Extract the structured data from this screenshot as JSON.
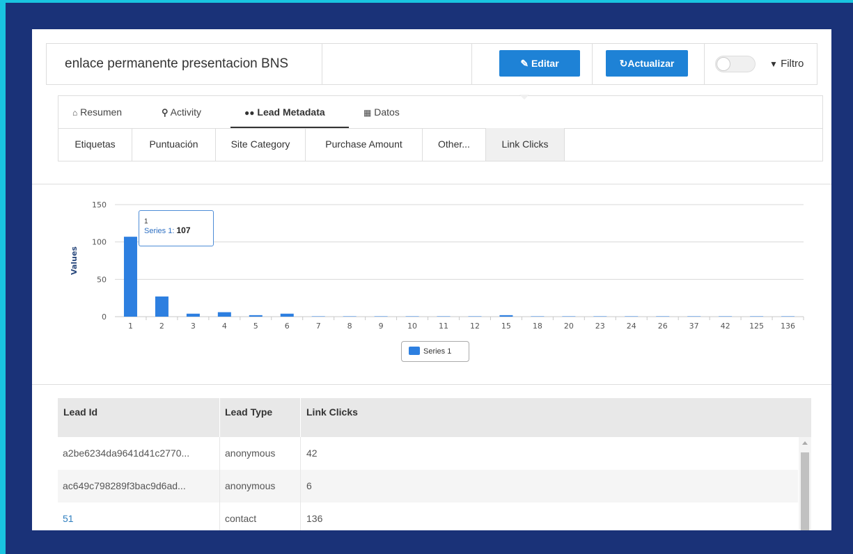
{
  "header": {
    "title": "enlace permanente presentacion BNS",
    "edit_label": "Editar",
    "update_label": "Actualizar",
    "filter_label": "Filtro",
    "toggle_on": false
  },
  "tabs": [
    {
      "label": "Resumen",
      "icon": "home-icon"
    },
    {
      "label": "Activity",
      "icon": "search-icon"
    },
    {
      "label": "Lead Metadata",
      "icon": "users-icon",
      "active": true
    },
    {
      "label": "Datos",
      "icon": "table-icon"
    }
  ],
  "subtabs": [
    "Etiquetas",
    "Puntuación",
    "Site Category",
    "Purchase Amount",
    "Other...",
    "Link Clicks"
  ],
  "active_subtab": "Link Clicks",
  "tooltip": {
    "category": "1",
    "series": "Series 1",
    "value": "107"
  },
  "chart_data": {
    "type": "bar",
    "ylabel": "Values",
    "xlabel": "",
    "ylim": [
      0,
      150
    ],
    "yticks": [
      0,
      50,
      100,
      150
    ],
    "categories": [
      "1",
      "2",
      "3",
      "4",
      "5",
      "6",
      "7",
      "8",
      "9",
      "10",
      "11",
      "12",
      "15",
      "18",
      "20",
      "23",
      "24",
      "26",
      "37",
      "42",
      "125",
      "136"
    ],
    "series": [
      {
        "name": "Series 1",
        "color": "#2d7fe0",
        "values": [
          107,
          27,
          4,
          6,
          2,
          4,
          0.5,
          0.5,
          0.5,
          0.5,
          0.5,
          0.5,
          2,
          0.5,
          0.5,
          0.5,
          0.5,
          0.5,
          0.5,
          0.5,
          0.5,
          0.5
        ]
      }
    ],
    "legend": "bottom-center",
    "grid": true
  },
  "table": {
    "headers": [
      "Lead Id",
      "Lead Type",
      "Link Clicks"
    ],
    "rows": [
      {
        "id": "a2be6234da9641d41c2770...",
        "type": "anonymous",
        "clicks": "42",
        "link": false
      },
      {
        "id": "ac649c798289f3bac9d6ad...",
        "type": "anonymous",
        "clicks": "6",
        "link": false
      },
      {
        "id": "51",
        "type": "contact",
        "clicks": "136",
        "link": true
      }
    ]
  }
}
